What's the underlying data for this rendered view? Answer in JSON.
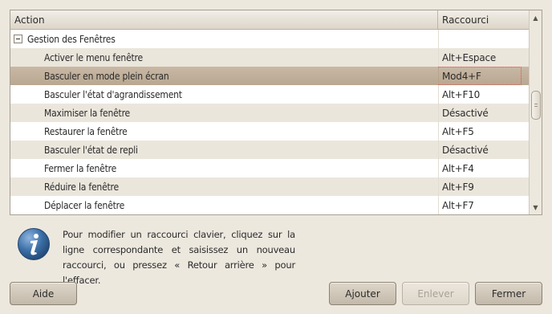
{
  "table": {
    "columns": {
      "action": "Action",
      "shortcut": "Raccourci"
    },
    "group": {
      "label": "Gestion des Fenêtres",
      "expanded": true
    },
    "rows": [
      {
        "action": "Activer le menu fenêtre",
        "shortcut": "Alt+Espace"
      },
      {
        "action": "Basculer en mode plein écran",
        "shortcut": "Mod4+F",
        "selected": true
      },
      {
        "action": "Basculer l'état d'agrandissement",
        "shortcut": "Alt+F10"
      },
      {
        "action": "Maximiser la fenêtre",
        "shortcut": "Désactivé"
      },
      {
        "action": "Restaurer la fenêtre",
        "shortcut": "Alt+F5"
      },
      {
        "action": "Basculer l'état de repli",
        "shortcut": "Désactivé"
      },
      {
        "action": "Fermer la fenêtre",
        "shortcut": "Alt+F4"
      },
      {
        "action": "Réduire la fenêtre",
        "shortcut": "Alt+F9"
      },
      {
        "action": "Déplacer la fenêtre",
        "shortcut": "Alt+F7"
      }
    ]
  },
  "info": {
    "icon": "info-icon",
    "text": "Pour modifier un raccourci clavier, cliquez sur la ligne correspondante et saisissez un nouveau raccourci, ou pressez « Retour arrière » pour l'effacer."
  },
  "buttons": {
    "help": "Aide",
    "add": "Ajouter",
    "remove": "Enlever",
    "close": "Fermer"
  },
  "colors": {
    "background": "#ede8de",
    "selected_row": "#c1b09b",
    "alt_row": "#ebe6dc",
    "info_icon": "#3a6ea5"
  }
}
